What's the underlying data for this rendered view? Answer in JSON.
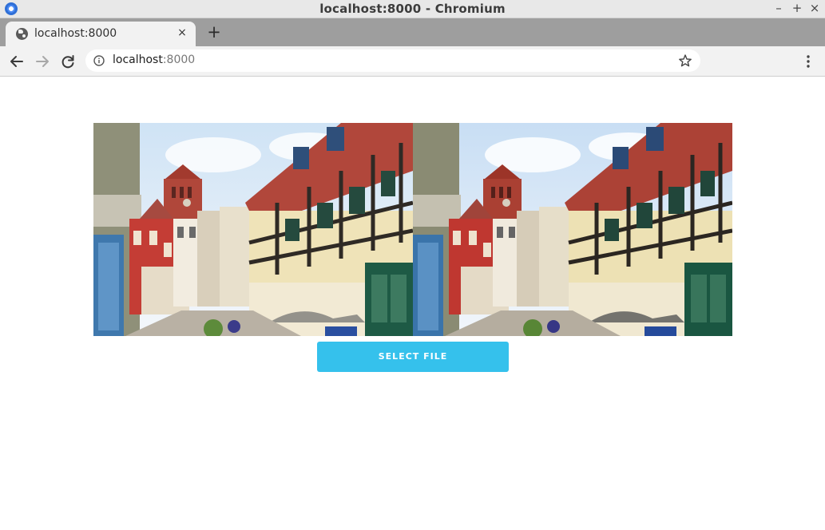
{
  "window": {
    "title": "localhost:8000 - Chromium",
    "controls": {
      "minimize": "–",
      "maximize": "+",
      "close": "×"
    }
  },
  "tabs": [
    {
      "label": "localhost:8000",
      "active": true
    }
  ],
  "newtab_label": "+",
  "tab_close_label": "×",
  "toolbar": {
    "url_host": "localhost",
    "url_port": ":8000"
  },
  "icons": {
    "app": "chromium-icon",
    "favicon": "globe-icon",
    "back": "arrow-left-icon",
    "forward": "arrow-right-icon",
    "reload": "reload-icon",
    "info": "info-icon",
    "bookmark": "star-icon",
    "menu": "vertical-dots-icon"
  },
  "colors": {
    "accent_button": "#35c1ec",
    "tabstrip": "#9e9e9e",
    "toolbar": "#f2f2f2"
  },
  "main": {
    "images": [
      {
        "name": "street-photo-original"
      },
      {
        "name": "street-photo-processed"
      }
    ],
    "select_button_label": "SELECT FILE"
  }
}
